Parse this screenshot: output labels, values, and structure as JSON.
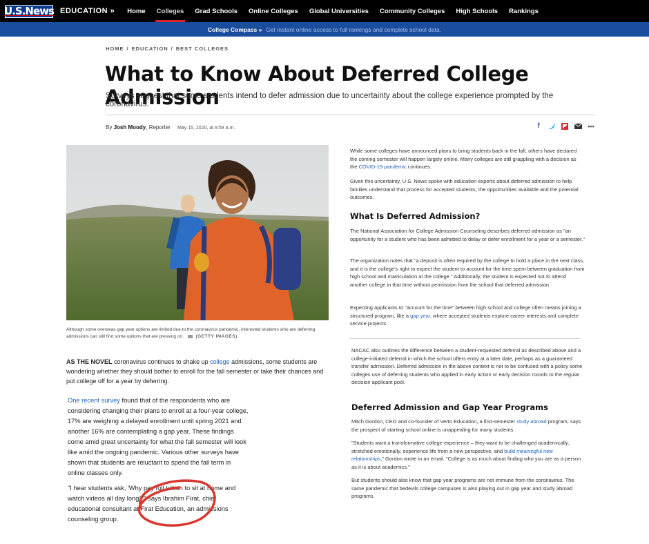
{
  "nav": {
    "logo": "U.S.News",
    "section": "EDUCATION »",
    "links": [
      "Home",
      "Colleges",
      "Grad Schools",
      "Online Colleges",
      "Global Universities",
      "Community Colleges",
      "High Schools",
      "Rankings"
    ],
    "active_index": 1
  },
  "compass": {
    "title": "College Compass »",
    "text": "Get instant online access to full rankings and complete school data."
  },
  "breadcrumb": [
    "HOME",
    "EDUCATION",
    "BEST COLLEGES"
  ],
  "article": {
    "title": "What to Know About Deferred College Admission",
    "dek": "Surveys suggest that some students intend to defer admission due to uncertainty about the college experience prompted by the coronavirus.",
    "byline_prefix": "By",
    "author": "Josh Moody",
    "author_role": ", Reporter",
    "date": "May 15, 2020, at 9:58 a.m."
  },
  "share_icons": [
    "facebook-icon",
    "twitter-icon",
    "flipboard-icon",
    "email-icon",
    "more-icon"
  ],
  "photo": {
    "caption": "Although some overseas gap year options are limited due to the coronavirus pandemic, interested students who are deferring admissions can still find some options that are pressing on.",
    "credit": "(GETTY IMAGES)"
  },
  "left": {
    "lead_caps": "AS THE NOVEL",
    "lead_a": " coronavirus continues to shake up ",
    "lead_link": "college",
    "lead_b": " admissions, some students are wondering whether they should bother to enroll for the fall semester or take their chances and put college off for a year by deferring.",
    "p2_link": "One recent survey",
    "p2_text": " found that of the respondents who are considering changing their plans to enroll at a four-year college, 17% are weighing a delayed enrollment until spring 2021 and another 16% are contemplating a gap year. These findings come amid great uncertainty for what the fall semester will look like amid the ongoing pandemic. Various other surveys have shown that students are reluctant to spend the fall term in online classes only.",
    "p3_text": "\"I hear students ask, 'Why pay full tuition to sit at home and watch videos all day long?'\" says Ibrahim Firat, chief educational consultant at Firat Education, an admissions counseling group."
  },
  "right": {
    "r1_a": "While some colleges have announced plans to bring students back in the fall, others have declared the coming semester will happen largely online. Many colleges are still grappling with a decision as the ",
    "r1_link": "COVID-19 pandemic",
    "r1_b": " continues.",
    "r2": "Given this uncertainty, U.S. News spoke with education experts about deferred admission to help families understand that process for accepted students, the opportunities available and the potential outcomes.",
    "h1": "What Is Deferred Admission?",
    "r3": "The National Association for College Admission Counseling describes deferred admission as \"an opportunity for a student who has been admitted to delay or defer enrollment for a year or a semester.\"",
    "r4": "The organization notes that \"a deposit is often required by the college to hold a place in the next class, and it is the college's right to expect the student to account for the time spent between graduation from high school and matriculation at the college.\" Additionally, the student is expected not to attend another college in that time without permission from the school that deferred admission.",
    "r5_a": "Expecting applicants to \"account for the time\" between high school and college often means joining a structured program, like a ",
    "r5_link": "gap year",
    "r5_b": ", where accepted students explore career interests and complete service projects.",
    "r6": "NACAC also outlines the difference between a student-requested deferral as described above and a college-initiated deferral in which the school offers entry at a later date, perhaps as a guaranteed transfer admission. Deferred admission in the above context is not to be confused with a policy some colleges use of deferring students who applied in early action or early decision rounds to the regular decision applicant pool.",
    "h2": "Deferred Admission and Gap Year Programs",
    "r7_a": "Mitch Gordon, CEO and co-founder of Verto Education, a first-semester ",
    "r7_link": "study abroad",
    "r7_b": " program, says the prospect of starting school online is unappealing for many students.",
    "r8_a": "\"Students want a transformative college experience – they want to be challenged academically, stretched emotionally, experience life from a new perspective, and ",
    "r8_link": "build meaningful new relationships",
    "r8_b": ",\" Gordon wrote in an email. \"College is as much about finding who you are as a person as it is about academics.\"",
    "r9": "But students should also know that gap year programs are not immune from the coronavirus. The same pandemic that bedevils college campuses is also playing out in gap year and study abroad programs."
  }
}
